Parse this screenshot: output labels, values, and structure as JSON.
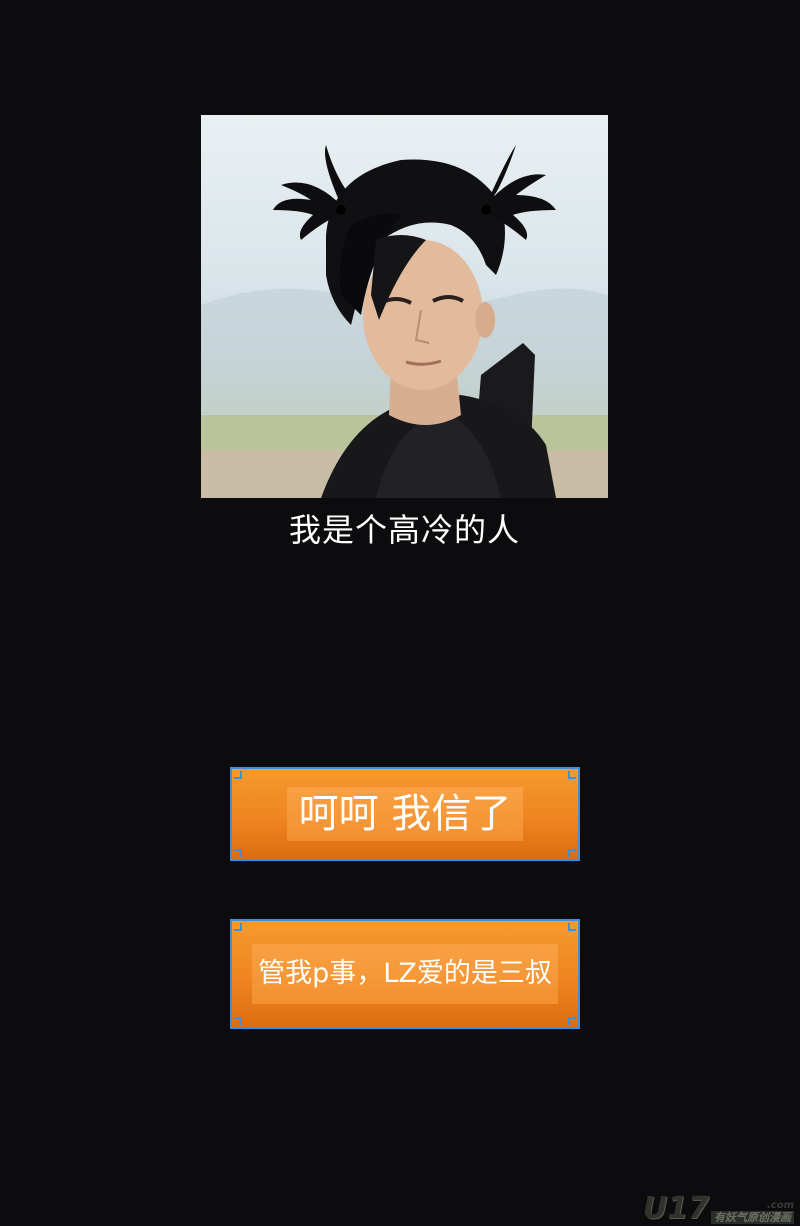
{
  "photo": {
    "icon": "portrait-with-pigtails-image"
  },
  "caption": "我是个高冷的人",
  "choices": [
    {
      "label": "呵呵 我信了"
    },
    {
      "label": "管我p事，LZ爱的是三叔"
    }
  ],
  "colors": {
    "background": "#0c0c0e",
    "button_fill": "#ef8520",
    "button_border": "#3f8fe0",
    "text": "#ffffff"
  },
  "watermark": {
    "logo": "U17",
    "domain": ".com",
    "slogan": "有妖气原创漫画"
  }
}
